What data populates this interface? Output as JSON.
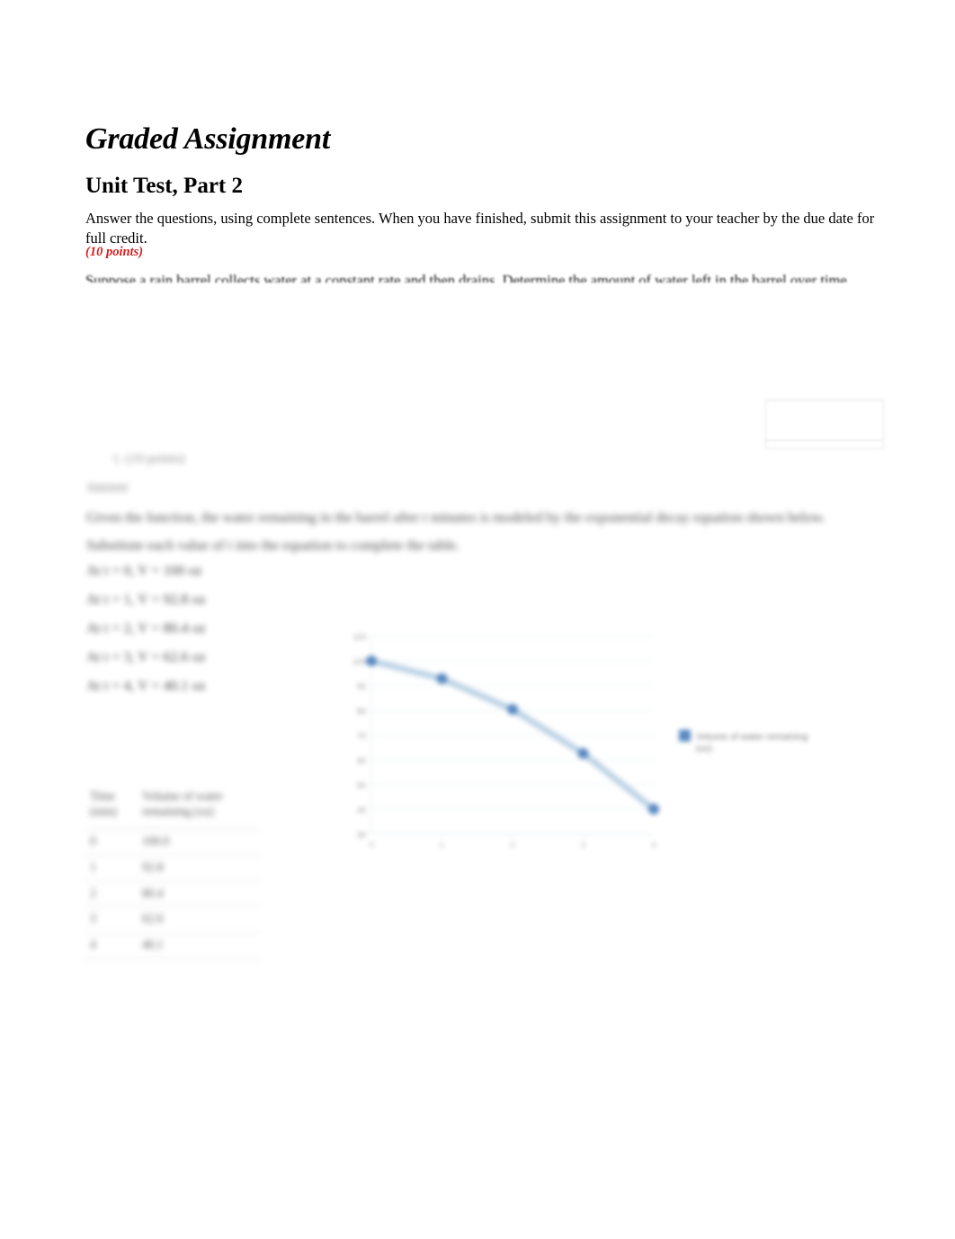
{
  "document": {
    "title": "Graded Assignment",
    "subtitle": "Unit Test, Part 2",
    "instructions": "Answer the questions, using complete sentences. When you have finished, submit this assignment to your teacher by the due date for full credit.",
    "points": "(10 points)",
    "clipped_line": "Suppose a rain barrel collects water at a constant rate and then drains. Determine the amount of water left in the barrel over time.",
    "question_label": "1. (10 points)",
    "answer_label": "Answer",
    "body_paragraph": "Given the function, the water remaining in the barrel after t minutes is modeled by the exponential decay equation shown below. Substitute each value of t into the equation to complete the table.",
    "calculations": [
      "At t = 0, V = 100 oz",
      "At t = 1, V = 92.8 oz",
      "At t = 2, V = 80.4 oz",
      "At t = 3, V = 62.6 oz",
      "At t = 4, V = 40.1 oz"
    ]
  },
  "table": {
    "headers": [
      "Time (min)",
      "Volume of water remaining (oz)"
    ],
    "rows": [
      [
        "0",
        "100.0"
      ],
      [
        "1",
        "92.8"
      ],
      [
        "2",
        "80.4"
      ],
      [
        "3",
        "62.6"
      ],
      [
        "4",
        "40.1"
      ]
    ]
  },
  "chart_data": {
    "type": "line",
    "title": "",
    "xlabel": "",
    "ylabel": "",
    "categories": [
      "0",
      "1",
      "2",
      "3",
      "4"
    ],
    "x": [
      0,
      1,
      2,
      3,
      4
    ],
    "series": [
      {
        "name": "Volume of water remaining (oz)",
        "values": [
          100.0,
          92.8,
          80.4,
          62.6,
          40.1
        ],
        "color": "#4a7ebb",
        "line_color": "#b7cfe3",
        "marker": "circle"
      }
    ],
    "ylim": [
      30,
      110
    ],
    "yticks": [
      30,
      40,
      50,
      60,
      70,
      80,
      90,
      100,
      110
    ],
    "ytick_labels": [
      "30",
      "40",
      "50",
      "60",
      "70",
      "80",
      "90",
      "100",
      "110"
    ],
    "xticks": [
      0,
      1,
      2,
      3,
      4
    ],
    "xtick_labels": [
      "0",
      "1",
      "2",
      "3",
      "4"
    ],
    "grid": true,
    "grid_color": "#e8eef3",
    "legend_position": "right",
    "legend_entries": [
      "Volume of water remaining (oz)"
    ]
  }
}
